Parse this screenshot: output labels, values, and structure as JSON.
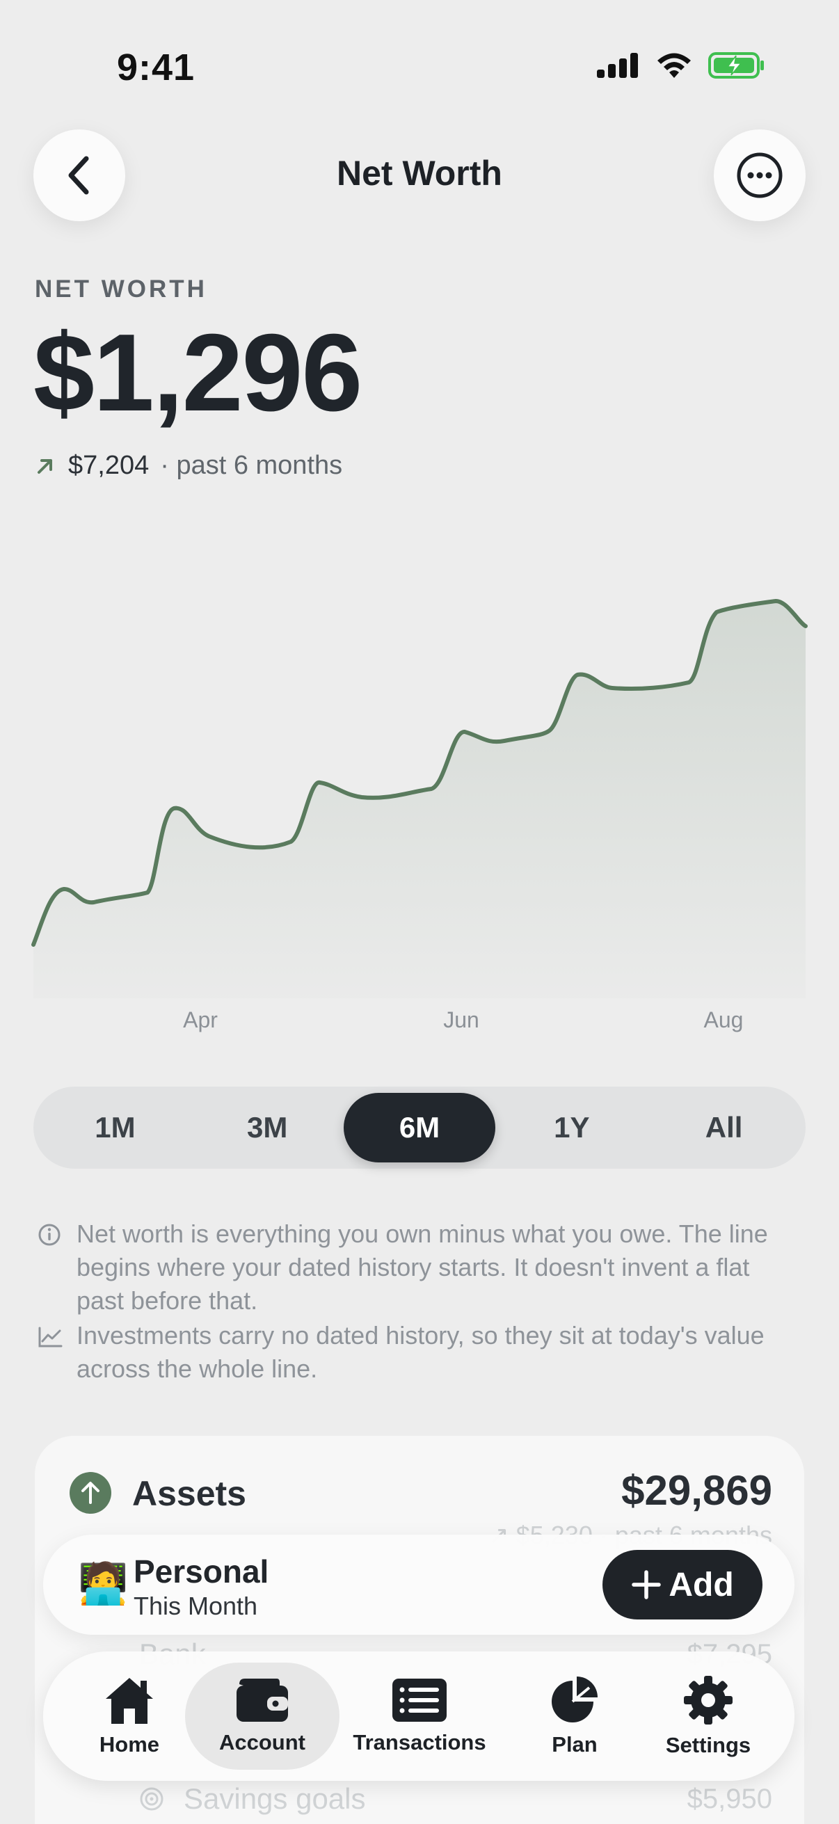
{
  "status_bar": {
    "time": "9:41"
  },
  "header": {
    "title": "Net Worth"
  },
  "summary": {
    "label": "NET WORTH",
    "value": "$1,296",
    "change_amount": "$7,204",
    "change_period": "· past 6 months"
  },
  "chart_data": {
    "type": "area",
    "x_tick_labels": [
      "Apr",
      "Jun",
      "Aug"
    ],
    "line_color": "#5a7b5e",
    "grid": false
  },
  "range_selector": {
    "options": [
      "1M",
      "3M",
      "6M",
      "1Y",
      "All"
    ],
    "selected": "6M"
  },
  "notes": {
    "note1": "Net worth is everything you own minus what you owe. The line begins where your dated history starts. It doesn't invent a flat past before that.",
    "note2": "Investments carry no dated history, so they sit at today's value across the whole line."
  },
  "assets": {
    "title": "Assets",
    "total": "$29,869",
    "change": "↗ $5,230 · past 6 months",
    "rows": [
      {
        "label": "Bank",
        "value": "$7,295"
      },
      {
        "label": "Savings goals",
        "value": "$5,950"
      }
    ]
  },
  "profile_bar": {
    "avatar": "🧑‍💻",
    "name": "Personal",
    "subtitle": "This Month",
    "add_label": "Add"
  },
  "tabs": [
    {
      "label": "Home",
      "icon": "home-icon"
    },
    {
      "label": "Account",
      "icon": "wallet-icon"
    },
    {
      "label": "Transactions",
      "icon": "list-icon"
    },
    {
      "label": "Plan",
      "icon": "pie-chart-icon"
    },
    {
      "label": "Settings",
      "icon": "gear-icon"
    }
  ],
  "colors": {
    "accent_green": "#5a7b5e",
    "dark": "#22272d",
    "background": "#ededed"
  }
}
